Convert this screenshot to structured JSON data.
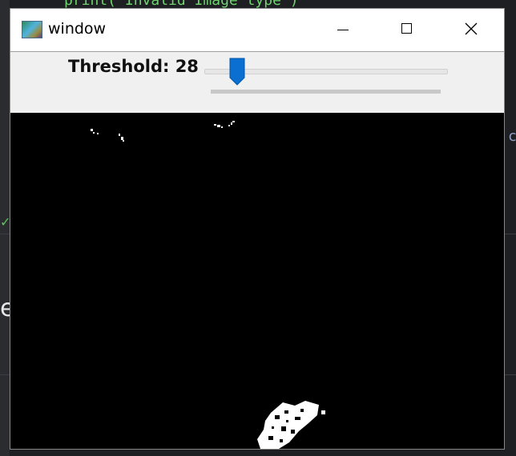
{
  "background": {
    "code_snippet": "print( Invalid Image type )",
    "check_glyph": "✓",
    "partial_letter_e": "e",
    "partial_letter_c": "c"
  },
  "window": {
    "title": "window",
    "app_icon": "opencv-window-icon",
    "controls": {
      "minimize": "minimize-icon",
      "maximize": "maximize-icon",
      "close": "close-icon"
    }
  },
  "trackbar": {
    "label": "Threshold: 28",
    "value": 28
  },
  "canvas": {
    "background_color": "#000000",
    "foreground_color": "#ffffff"
  }
}
